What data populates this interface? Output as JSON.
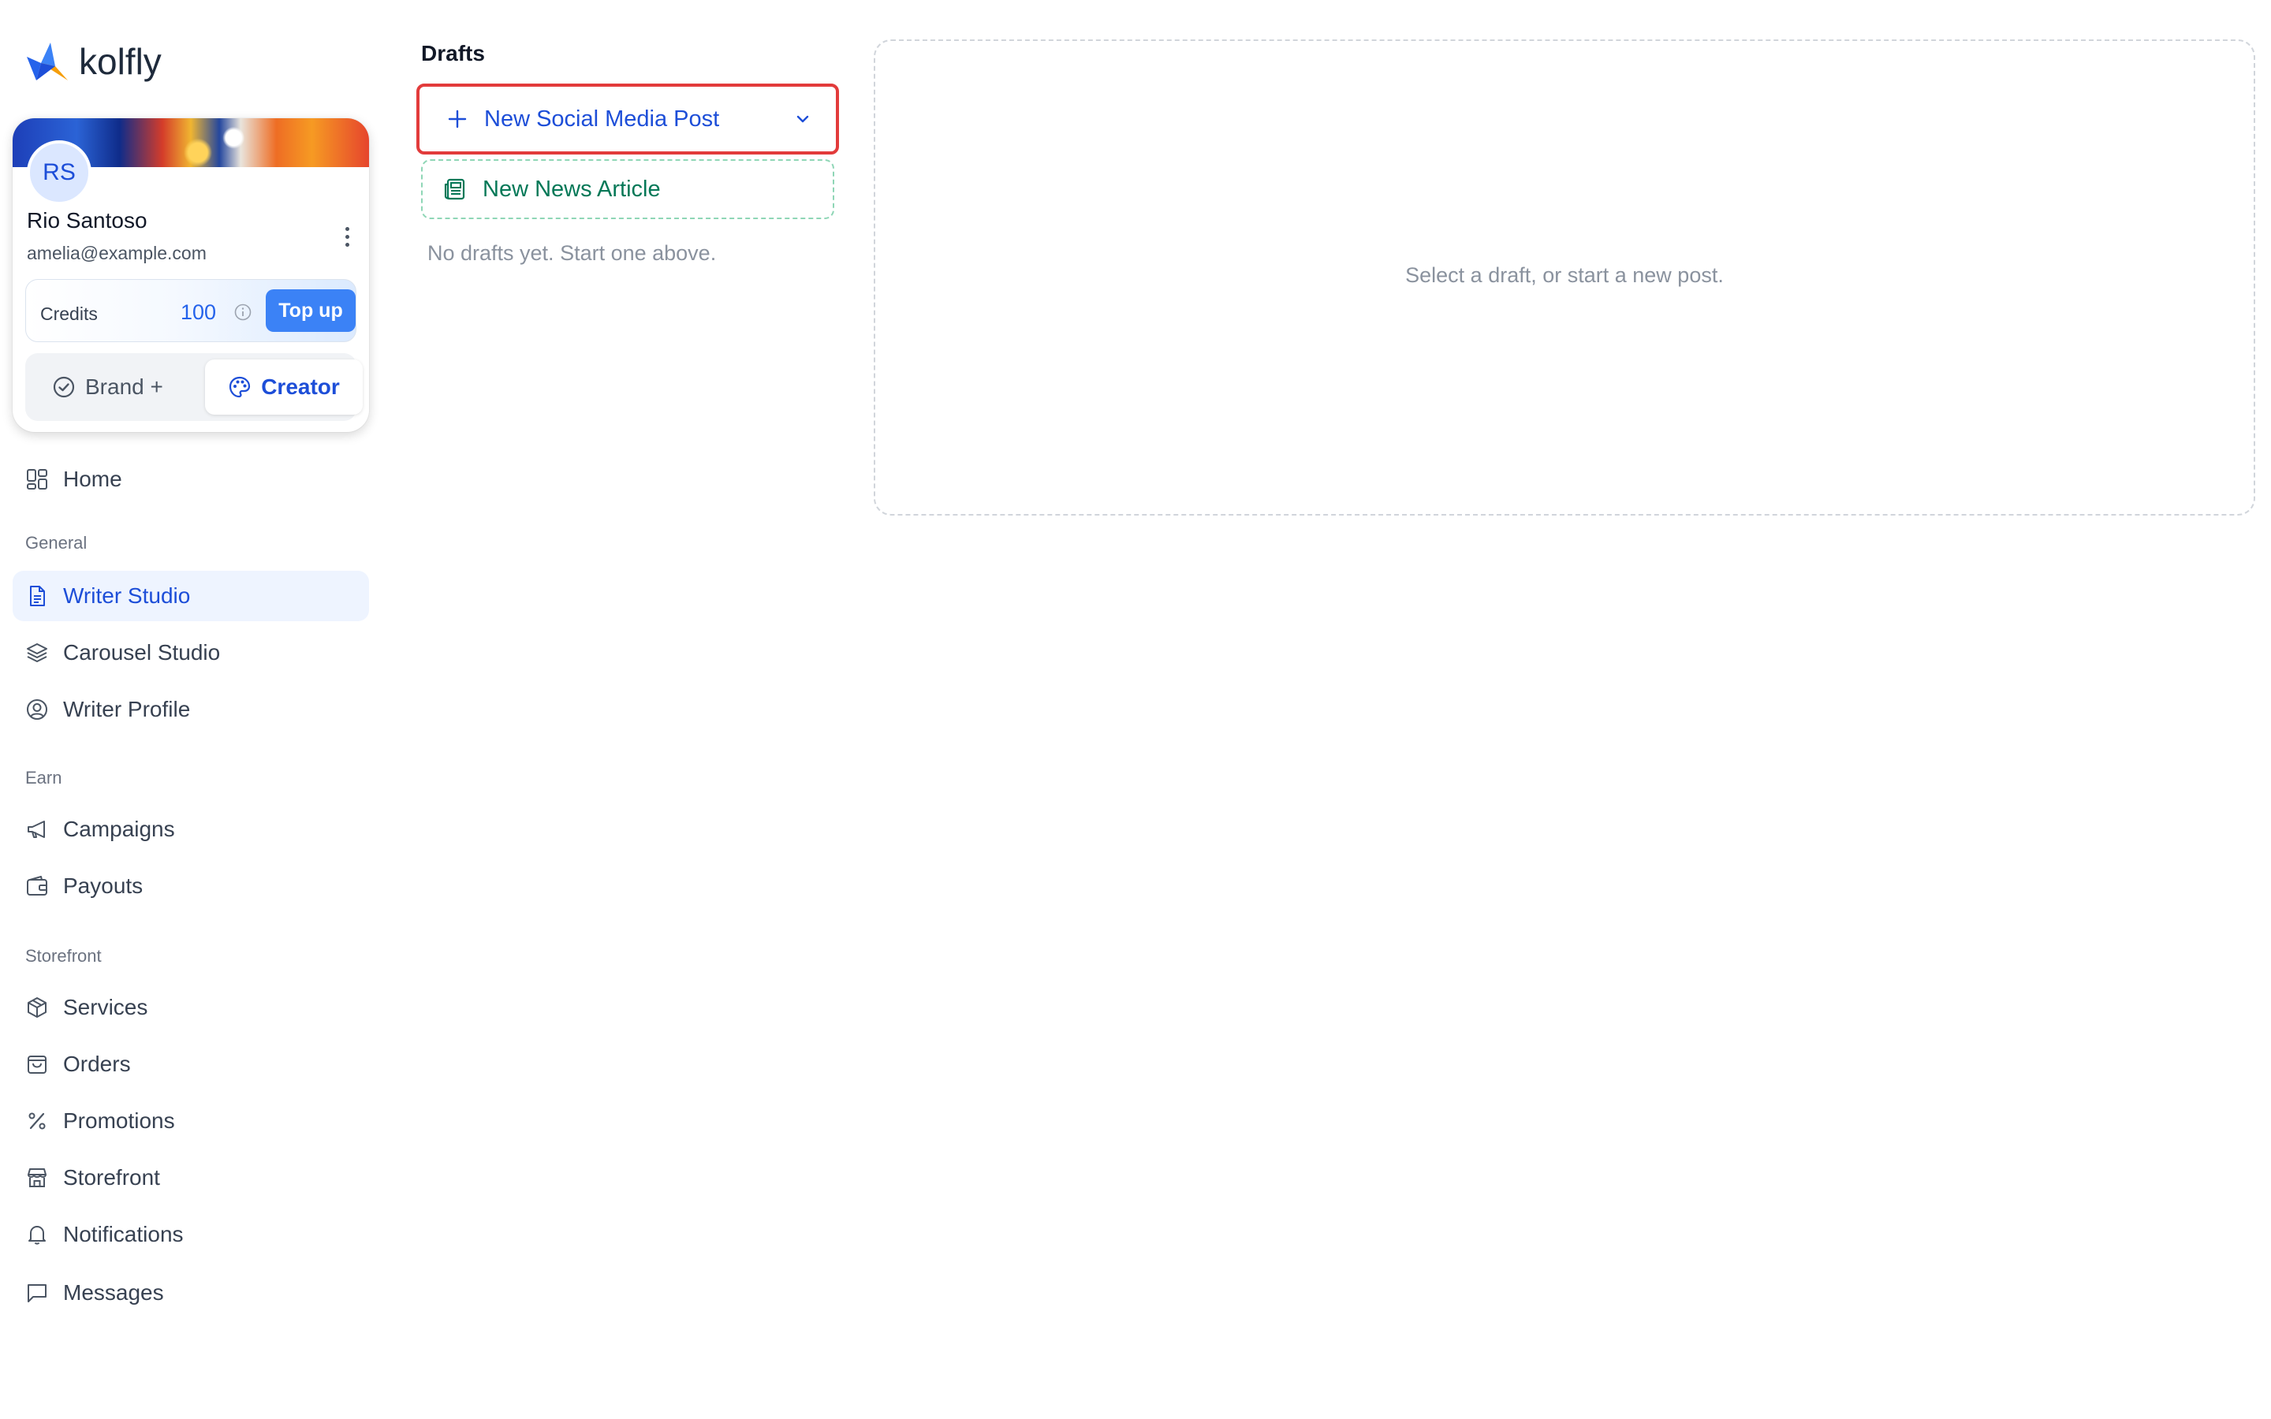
{
  "app": {
    "logo_text": "kolfly",
    "brand_colors": {
      "primary": "#2563eb",
      "accent": "#f59e0b",
      "highlight_border": "#e23b3b",
      "green": "#047857"
    }
  },
  "profile": {
    "initials": "RS",
    "name": "Rio Santoso",
    "email": "amelia@example.com",
    "credits_label": "Credits",
    "credits_value": "100",
    "topup_label": "Top up",
    "mode_brand_label": "Brand +",
    "mode_creator_label": "Creator",
    "active_mode": "Creator"
  },
  "nav": {
    "home": "Home",
    "sections": {
      "general": "General",
      "earn": "Earn",
      "storefront": "Storefront"
    },
    "general_items": [
      "Writer Studio",
      "Carousel Studio",
      "Writer Profile"
    ],
    "earn_items": [
      "Campaigns",
      "Payouts"
    ],
    "storefront_items": [
      "Services",
      "Orders",
      "Promotions",
      "Storefront",
      "Notifications",
      "Messages"
    ],
    "active_item": "Writer Studio"
  },
  "drafts": {
    "title": "Drafts",
    "new_post_label": "New Social Media Post",
    "new_article_label": "New News Article",
    "empty_message": "No drafts yet. Start one above."
  },
  "editor": {
    "placeholder": "Select a draft, or start a new post."
  }
}
